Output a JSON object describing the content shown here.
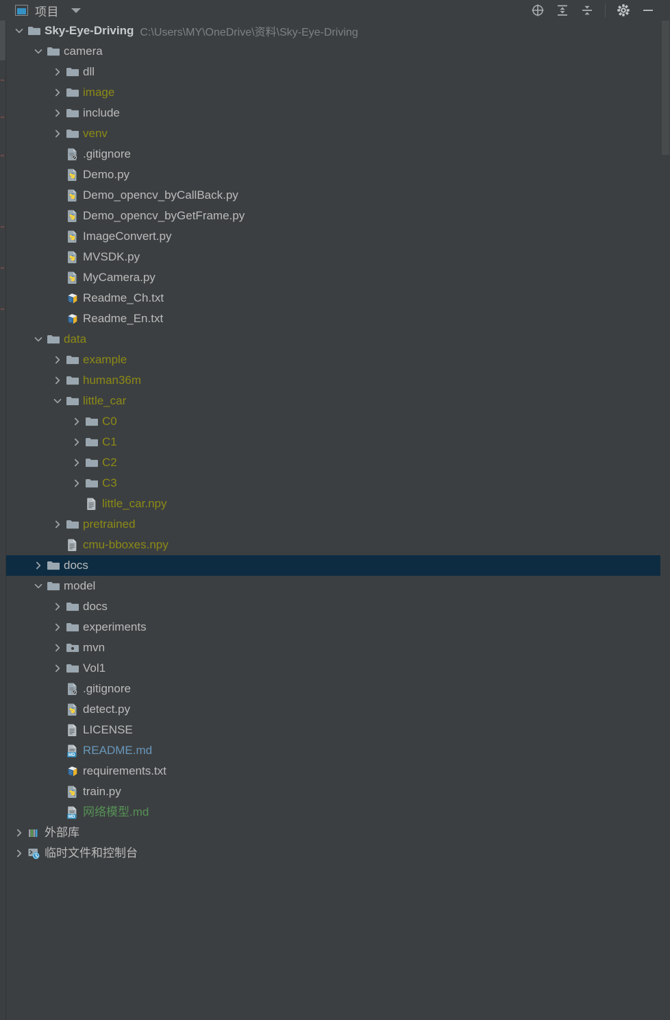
{
  "header": {
    "title": "项目",
    "project_icon": "project-panel-icon",
    "dropdown_icon": "chevron-down-icon",
    "actions": [
      {
        "name": "select-opened-file-icon",
        "label": "Select Opened File"
      },
      {
        "name": "expand-all-icon",
        "label": "Expand All"
      },
      {
        "name": "collapse-all-icon",
        "label": "Collapse All"
      },
      {
        "name": "settings-gear-icon",
        "label": "Settings"
      },
      {
        "name": "hide-panel-icon",
        "label": "Hide"
      }
    ]
  },
  "tree": {
    "rows": [
      {
        "indent": 0,
        "twisty": "expanded",
        "icon": "folder",
        "label": "Sky-Eye-Driving",
        "style": "bold",
        "sub": "C:\\Users\\MY\\OneDrive\\资料\\Sky-Eye-Driving",
        "selected": false
      },
      {
        "indent": 1,
        "twisty": "expanded",
        "icon": "folder",
        "label": "camera",
        "style": "plain",
        "sub": "",
        "selected": false
      },
      {
        "indent": 2,
        "twisty": "collapsed",
        "icon": "folder",
        "label": "dll",
        "style": "plain",
        "sub": "",
        "selected": false
      },
      {
        "indent": 2,
        "twisty": "collapsed",
        "icon": "folder",
        "label": "image",
        "style": "yellow",
        "sub": "",
        "selected": false
      },
      {
        "indent": 2,
        "twisty": "collapsed",
        "icon": "folder",
        "label": "include",
        "style": "plain",
        "sub": "",
        "selected": false
      },
      {
        "indent": 2,
        "twisty": "collapsed",
        "icon": "folder",
        "label": "venv",
        "style": "yellow",
        "sub": "",
        "selected": false
      },
      {
        "indent": 2,
        "twisty": "none",
        "icon": "gitignore",
        "label": ".gitignore",
        "style": "plain",
        "sub": "",
        "selected": false
      },
      {
        "indent": 2,
        "twisty": "none",
        "icon": "python",
        "label": "Demo.py",
        "style": "plain",
        "sub": "",
        "selected": false
      },
      {
        "indent": 2,
        "twisty": "none",
        "icon": "python",
        "label": "Demo_opencv_byCallBack.py",
        "style": "plain",
        "sub": "",
        "selected": false
      },
      {
        "indent": 2,
        "twisty": "none",
        "icon": "python",
        "label": "Demo_opencv_byGetFrame.py",
        "style": "plain",
        "sub": "",
        "selected": false
      },
      {
        "indent": 2,
        "twisty": "none",
        "icon": "python",
        "label": "ImageConvert.py",
        "style": "plain",
        "sub": "",
        "selected": false
      },
      {
        "indent": 2,
        "twisty": "none",
        "icon": "python",
        "label": "MVSDK.py",
        "style": "plain",
        "sub": "",
        "selected": false
      },
      {
        "indent": 2,
        "twisty": "none",
        "icon": "python",
        "label": "MyCamera.py",
        "style": "plain",
        "sub": "",
        "selected": false
      },
      {
        "indent": 2,
        "twisty": "none",
        "icon": "text3d",
        "label": "Readme_Ch.txt",
        "style": "plain",
        "sub": "",
        "selected": false
      },
      {
        "indent": 2,
        "twisty": "none",
        "icon": "text3d",
        "label": "Readme_En.txt",
        "style": "plain",
        "sub": "",
        "selected": false
      },
      {
        "indent": 1,
        "twisty": "expanded",
        "icon": "folder",
        "label": "data",
        "style": "yellow",
        "sub": "",
        "selected": false
      },
      {
        "indent": 2,
        "twisty": "collapsed",
        "icon": "folder",
        "label": "example",
        "style": "yellow",
        "sub": "",
        "selected": false
      },
      {
        "indent": 2,
        "twisty": "collapsed",
        "icon": "folder",
        "label": "human36m",
        "style": "yellow",
        "sub": "",
        "selected": false
      },
      {
        "indent": 2,
        "twisty": "expanded",
        "icon": "folder",
        "label": "little_car",
        "style": "yellow",
        "sub": "",
        "selected": false
      },
      {
        "indent": 3,
        "twisty": "collapsed",
        "icon": "folder",
        "label": "C0",
        "style": "yellow",
        "sub": "",
        "selected": false
      },
      {
        "indent": 3,
        "twisty": "collapsed",
        "icon": "folder",
        "label": "C1",
        "style": "yellow",
        "sub": "",
        "selected": false
      },
      {
        "indent": 3,
        "twisty": "collapsed",
        "icon": "folder",
        "label": "C2",
        "style": "yellow",
        "sub": "",
        "selected": false
      },
      {
        "indent": 3,
        "twisty": "collapsed",
        "icon": "folder",
        "label": "C3",
        "style": "yellow",
        "sub": "",
        "selected": false
      },
      {
        "indent": 3,
        "twisty": "none",
        "icon": "file",
        "label": "little_car.npy",
        "style": "yellow",
        "sub": "",
        "selected": false
      },
      {
        "indent": 2,
        "twisty": "collapsed",
        "icon": "folder",
        "label": "pretrained",
        "style": "yellow",
        "sub": "",
        "selected": false
      },
      {
        "indent": 2,
        "twisty": "none",
        "icon": "file",
        "label": "cmu-bboxes.npy",
        "style": "yellow",
        "sub": "",
        "selected": false
      },
      {
        "indent": 1,
        "twisty": "collapsed",
        "icon": "folder",
        "label": "docs",
        "style": "plain",
        "sub": "",
        "selected": true
      },
      {
        "indent": 1,
        "twisty": "expanded",
        "icon": "folder",
        "label": "model",
        "style": "plain",
        "sub": "",
        "selected": false
      },
      {
        "indent": 2,
        "twisty": "collapsed",
        "icon": "folder",
        "label": "docs",
        "style": "plain",
        "sub": "",
        "selected": false
      },
      {
        "indent": 2,
        "twisty": "collapsed",
        "icon": "folder",
        "label": "experiments",
        "style": "plain",
        "sub": "",
        "selected": false
      },
      {
        "indent": 2,
        "twisty": "collapsed",
        "icon": "module",
        "label": "mvn",
        "style": "plain",
        "sub": "",
        "selected": false
      },
      {
        "indent": 2,
        "twisty": "collapsed",
        "icon": "folder",
        "label": "Vol1",
        "style": "plain",
        "sub": "",
        "selected": false
      },
      {
        "indent": 2,
        "twisty": "none",
        "icon": "gitignore",
        "label": ".gitignore",
        "style": "plain",
        "sub": "",
        "selected": false
      },
      {
        "indent": 2,
        "twisty": "none",
        "icon": "python",
        "label": "detect.py",
        "style": "plain",
        "sub": "",
        "selected": false
      },
      {
        "indent": 2,
        "twisty": "none",
        "icon": "file",
        "label": "LICENSE",
        "style": "plain",
        "sub": "",
        "selected": false
      },
      {
        "indent": 2,
        "twisty": "none",
        "icon": "markdown",
        "label": "README.md",
        "style": "blue",
        "sub": "",
        "selected": false
      },
      {
        "indent": 2,
        "twisty": "none",
        "icon": "text3d",
        "label": "requirements.txt",
        "style": "plain",
        "sub": "",
        "selected": false
      },
      {
        "indent": 2,
        "twisty": "none",
        "icon": "python",
        "label": "train.py",
        "style": "plain",
        "sub": "",
        "selected": false
      },
      {
        "indent": 2,
        "twisty": "none",
        "icon": "markdown",
        "label": "网络模型.md",
        "style": "green",
        "sub": "",
        "selected": false
      },
      {
        "indent": 0,
        "twisty": "collapsed",
        "icon": "library",
        "label": "外部库",
        "style": "plain",
        "sub": "",
        "selected": false
      },
      {
        "indent": 0,
        "twisty": "collapsed",
        "icon": "scratch",
        "label": "临时文件和控制台",
        "style": "plain",
        "sub": "",
        "selected": false
      }
    ]
  },
  "colors": {
    "background": "#3c3f41",
    "selection": "#0d2c42",
    "text": "#bbbbbb",
    "muted": "#7e8185",
    "excluded_yellow": "#8c8a16",
    "vcs_blue": "#6897bb",
    "vcs_green": "#559155",
    "folder_gray": "#9aa7b0"
  }
}
